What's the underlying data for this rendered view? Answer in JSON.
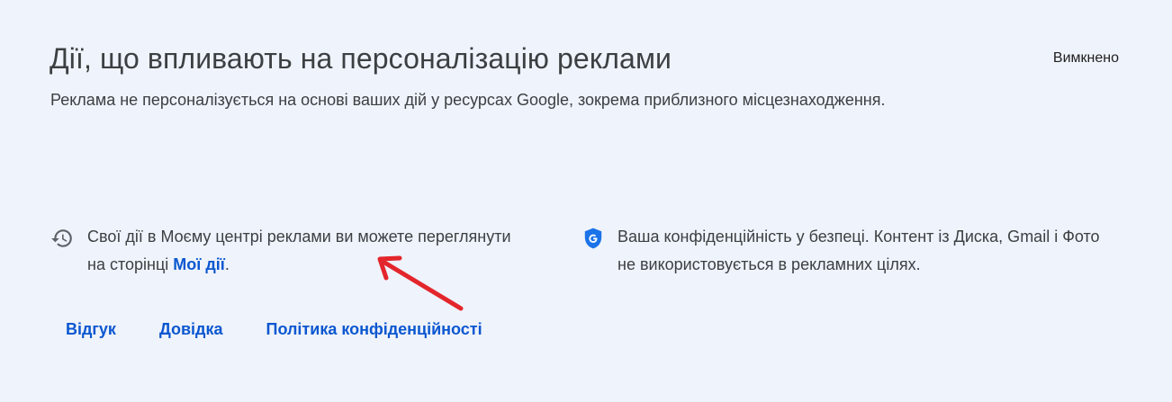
{
  "header": {
    "title": "Дії, що впливають на персоналізацію реклами",
    "status": "Вимкнено"
  },
  "description": "Реклама не персоналізується на основі ваших дій у ресурсах Google, зокрема приблизного місцезнаходження.",
  "activity_info": {
    "icon": "history-icon",
    "text_before": "Свої дії в Моєму центрі реклами ви можете переглянути на сторінці ",
    "link_label": "Мої дії",
    "text_after": "."
  },
  "privacy_info": {
    "icon": "google-shield-icon",
    "text": "Ваша конфіденційність у безпеці. Контент із Диска, Gmail і Фото не використовується в рекламних цілях."
  },
  "footer": {
    "links": [
      "Відгук",
      "Довідка",
      "Політика конфіденційності"
    ]
  },
  "annotation": {
    "icon": "red-arrow-icon",
    "color": "#e3262c"
  },
  "colors": {
    "background": "#eff3fb",
    "link": "#0b57d0",
    "icon_gray": "#5f6368",
    "shield_blue": "#1a73e8"
  }
}
